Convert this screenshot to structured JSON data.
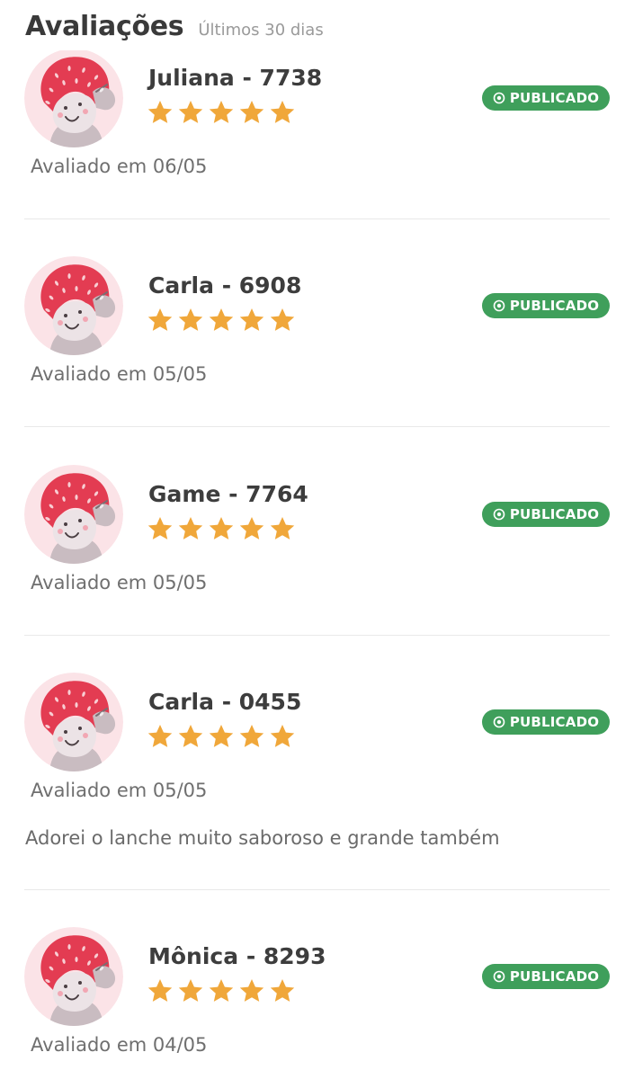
{
  "header": {
    "title": "Avaliações",
    "subtitle": "Últimos 30 dias"
  },
  "colors": {
    "badge": "#3f9f5b",
    "star": "#f0a73a",
    "avatar_bg": "#fbe3e7",
    "avatar_hair": "#e33c52"
  },
  "badge_icon": "eye-icon",
  "reviews": [
    {
      "name": "Juliana - 7738",
      "rating": 5,
      "status": "PUBLICADO",
      "date": "Avaliado em 06/05",
      "comment": ""
    },
    {
      "name": "Carla - 6908",
      "rating": 5,
      "status": "PUBLICADO",
      "date": "Avaliado em 05/05",
      "comment": ""
    },
    {
      "name": "Game - 7764",
      "rating": 5,
      "status": "PUBLICADO",
      "date": "Avaliado em 05/05",
      "comment": ""
    },
    {
      "name": "Carla - 0455",
      "rating": 5,
      "status": "PUBLICADO",
      "date": "Avaliado em 05/05",
      "comment": "Adorei o lanche muito saboroso e grande também"
    },
    {
      "name": "Mônica - 8293",
      "rating": 5,
      "status": "PUBLICADO",
      "date": "Avaliado em 04/05",
      "comment": ""
    }
  ]
}
